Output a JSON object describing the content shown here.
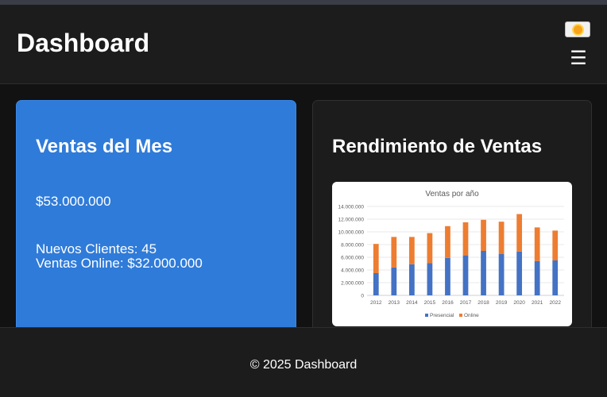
{
  "header": {
    "title": "Dashboard",
    "theme_toggle_icon": "sun-icon",
    "menu_icon": "hamburger-menu-icon",
    "menu_glyph": "☰"
  },
  "sales_card": {
    "title": "Ventas del Mes",
    "amount": "$53.000.000",
    "new_clients": "Nuevos Clientes: 45",
    "online_sales": "Ventas Online: $32.000.000",
    "background_color": "#2f7bd9"
  },
  "chart_card": {
    "title": "Rendimiento de Ventas"
  },
  "chart_data": {
    "type": "bar",
    "stacked": true,
    "title": "Ventas por año",
    "categories": [
      "2012",
      "2013",
      "2014",
      "2015",
      "2016",
      "2017",
      "2018",
      "2019",
      "2020",
      "2021",
      "2022"
    ],
    "series": [
      {
        "name": "Presencial",
        "color": "#4472c4",
        "values": [
          3500000,
          4400000,
          4900000,
          5100000,
          5900000,
          6300000,
          7000000,
          6500000,
          6900000,
          5400000,
          5500000
        ]
      },
      {
        "name": "Online",
        "color": "#ed7d31",
        "values": [
          4600000,
          4800000,
          4300000,
          4700000,
          5000000,
          5200000,
          4900000,
          5100000,
          5900000,
          5300000,
          4700000
        ]
      }
    ],
    "ylim": [
      0,
      14000000
    ],
    "y_ticks": [
      "0",
      "2.000.000",
      "4.000.000",
      "6.000.000",
      "8.000.000",
      "10.000.000",
      "12.000.000",
      "14.000.000"
    ],
    "grid": true,
    "legend_position": "bottom"
  },
  "footer": {
    "copyright": "© 2025 Dashboard"
  }
}
